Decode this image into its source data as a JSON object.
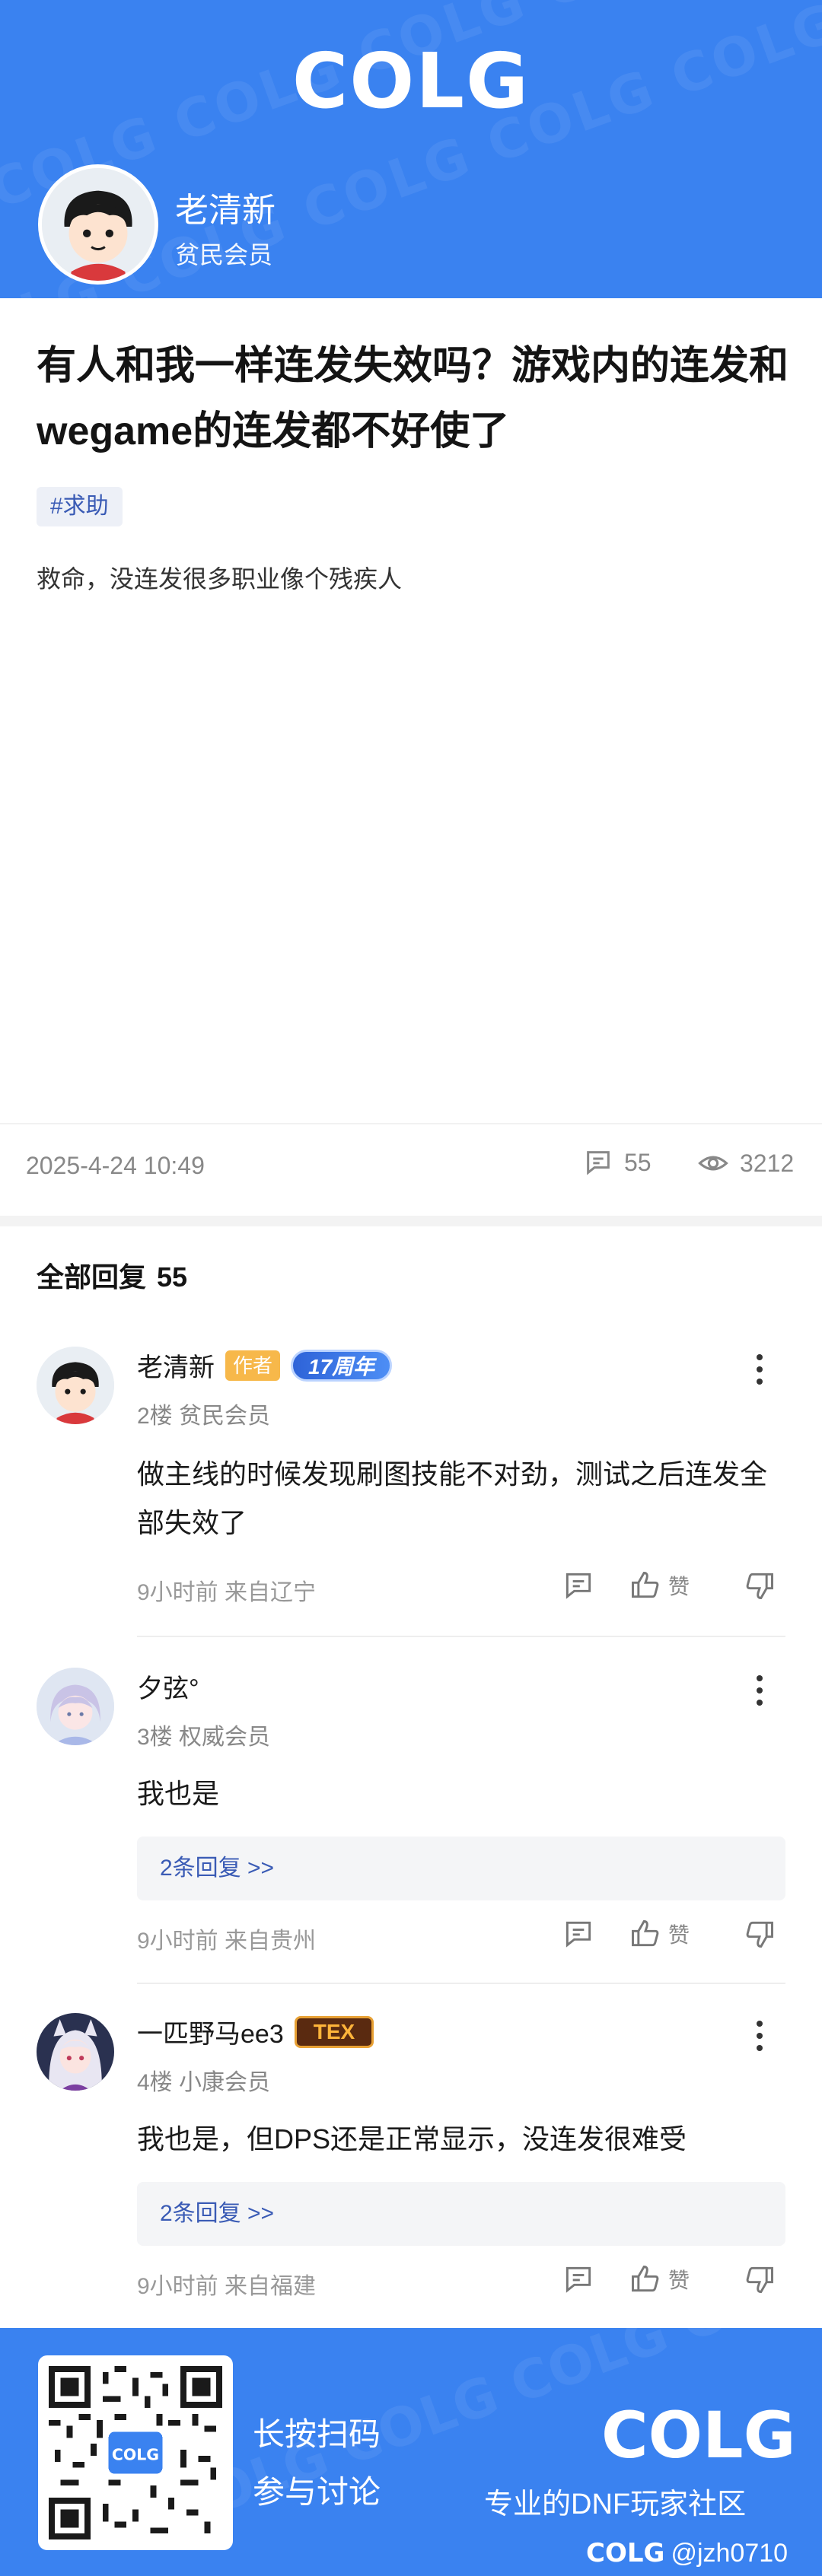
{
  "header": {
    "logo": "COLG",
    "author_name": "老清新",
    "author_rank": "贫民会员"
  },
  "post": {
    "title": "有人和我一样连发失效吗？游戏内的连发和wegame的连发都不好使了",
    "tag": "#求助",
    "body": "救命，没连发很多职业像个残疾人",
    "date": "2025-4-24 10:49",
    "comment_count": "55",
    "view_count": "3212"
  },
  "replies_heading": {
    "label": "全部回复",
    "count": "55"
  },
  "comments": [
    {
      "name": "老清新",
      "badge_author": "作者",
      "badge_anniv": "17周年",
      "floor": "2楼  贫民会员",
      "text": "做主线的时候发现刷图技能不对劲，测试之后连发全部失效了",
      "meta": "9小时前  来自辽宁",
      "like_label": "赞"
    },
    {
      "name": "夕弦°",
      "floor": "3楼  权威会员",
      "text": "我也是",
      "replies": "2条回复 >>",
      "meta": "9小时前  来自贵州",
      "like_label": "赞"
    },
    {
      "name": "一匹野马ee3",
      "badge_tex": "TEX",
      "floor": "4楼  小康会员",
      "text": "我也是，但DPS还是正常显示，没连发很难受",
      "replies": "2条回复 >>",
      "meta": "9小时前  来自福建",
      "like_label": "赞"
    }
  ],
  "footer": {
    "line1": "长按扫码",
    "line2": "参与讨论",
    "logo": "COLG",
    "slogan": "专业的DNF玩家社区",
    "watermark_logo": "COLG",
    "watermark_handle": "@jzh0710"
  },
  "colors": {
    "brand_blue": "#3a82f0",
    "link_blue": "#3a5bb5",
    "author_badge": "#f7b84a"
  }
}
